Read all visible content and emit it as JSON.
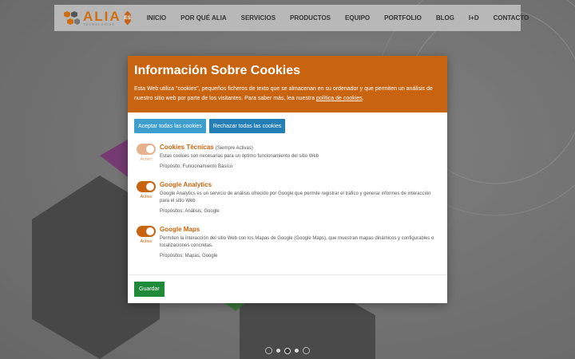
{
  "brand": {
    "name": "ALIA",
    "tagline": "TECNOLOGÍAS",
    "accent": "#c8640f"
  },
  "header": {
    "language": "ES",
    "nav": [
      "INICIO",
      "POR QUÉ ALIA",
      "SERVICIOS",
      "PRODUCTOS",
      "EQUIPO",
      "PORTFOLIO",
      "BLOG",
      "I+D",
      "CONTACTO"
    ]
  },
  "modal": {
    "title": "Información Sobre Cookies",
    "description": "Esta Web utiliza \"cookies\", pequeños ficheros de texto que se almacenan en su ordenador y que permiten un análisis de nuestro sitio web por parte de los visitantes. Para saber más, lea nuestra ",
    "policy_link": "política de cookies",
    "description_end": ".",
    "accept_all": "Aceptar todas las cookies",
    "reject_all": "Rechazar todas las cookies",
    "save": "Guardar",
    "cookies": [
      {
        "title": "Cookies Técnicas",
        "note": "(Siempre Activas)",
        "status": "Activo",
        "enabled": true,
        "locked": true,
        "description": "Estas cookies son necesarias para un óptimo funcionamiento del sitio Web",
        "purpose": "Propósito: Funcionamiento Básico"
      },
      {
        "title": "Google Analytics",
        "note": "",
        "status": "Activo",
        "enabled": true,
        "locked": false,
        "description": "Google Analytics es un servicio de análisis ofrecido por Google que permite registrar el tráfico y generar informes de interacción para el sitio Web",
        "purpose": "Propósitos: Análisis, Google"
      },
      {
        "title": "Google Maps",
        "note": "",
        "status": "Activo",
        "enabled": true,
        "locked": false,
        "description": "Permiten la interacción del sitio Web con los Mapas de Google (Google Maps), que muestran mapas dinámicos y configurables o localizaciones concretas.",
        "purpose": "Propósitos: Mapas, Google"
      }
    ]
  },
  "slider": {
    "dot_count": 3,
    "active_dot": 1
  }
}
